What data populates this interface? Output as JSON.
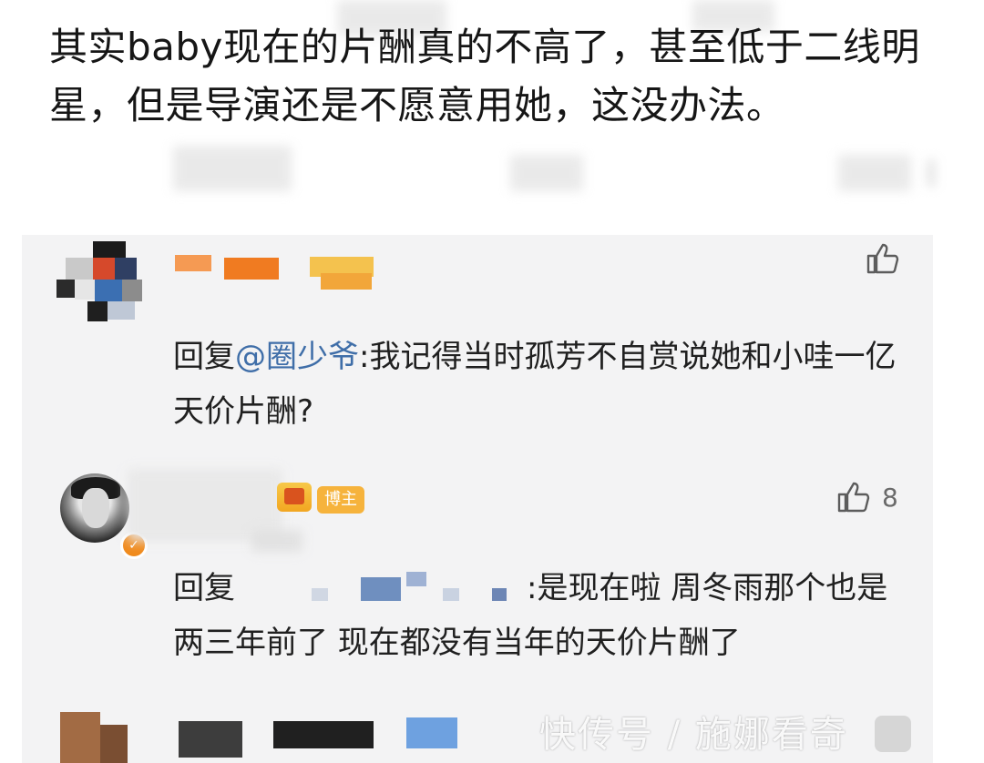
{
  "post_text": "其实baby现在的片酬真的不高了，甚至低于二线明星，但是导演还是不愿意用她，这没办法。",
  "comments": [
    {
      "reply_prefix": "回复",
      "mention": "@圈少爷",
      "text": ":我记得当时孤芳不自赏说她和小哇一亿天价片酬?",
      "like_count": ""
    },
    {
      "reply_prefix": "回复",
      "mention": "",
      "text": ":是现在啦 周冬雨那个也是两三年前了 现在都没有当年的天价片酬了",
      "like_count": "8",
      "badge": "博主"
    }
  ],
  "watermark": "快传号 / 施娜看奇",
  "colors": {
    "panel": "#f3f3f4",
    "mention": "#3f6ea8",
    "badge": "#f6b33c",
    "verified": "#f08a1c"
  }
}
